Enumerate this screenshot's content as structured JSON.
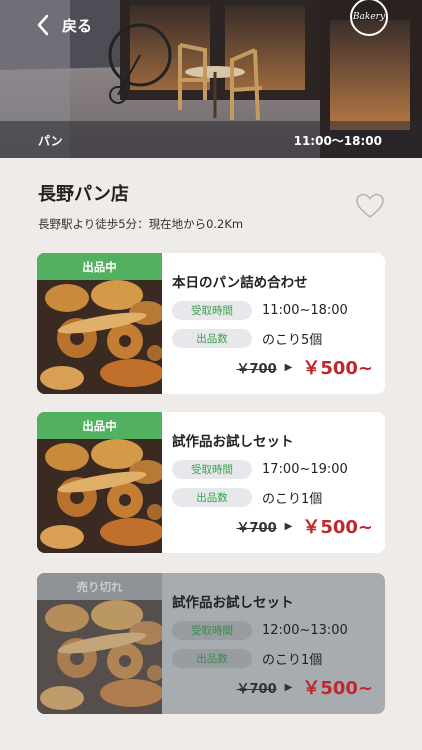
{
  "header": {
    "back_label": "戻る",
    "logo_text": "Bakery",
    "category": "パン",
    "hours": "11:00〜18:00"
  },
  "shop": {
    "name": "長野パン店",
    "access": "長野駅より徒歩5分：現在地から0.2Km"
  },
  "labels": {
    "pickup_time": "受取時間",
    "quantity": "出品数"
  },
  "offers": [
    {
      "status": "出品中",
      "title": "本日のパン詰め合わせ",
      "pickup_time": "11:00~18:00",
      "remaining": "のこり5個",
      "original_price": "￥700",
      "price": "￥500~",
      "sold_out": false
    },
    {
      "status": "出品中",
      "title": "試作品お試しセット",
      "pickup_time": "17:00~19:00",
      "remaining": "のこり1個",
      "original_price": "￥700",
      "price": "￥500~",
      "sold_out": false
    },
    {
      "status": "売り切れ",
      "title": "試作品お試しセット",
      "pickup_time": "12:00~13:00",
      "remaining": "のこり1個",
      "original_price": "￥700",
      "price": "￥500~",
      "sold_out": true
    }
  ],
  "colors": {
    "available_badge": "#52b061",
    "sold_badge": "#8d9397",
    "price": "#c0272d",
    "background": "#efebe8"
  },
  "icons": {
    "back": "chevron-left-icon",
    "favorite": "heart-outline-icon"
  }
}
